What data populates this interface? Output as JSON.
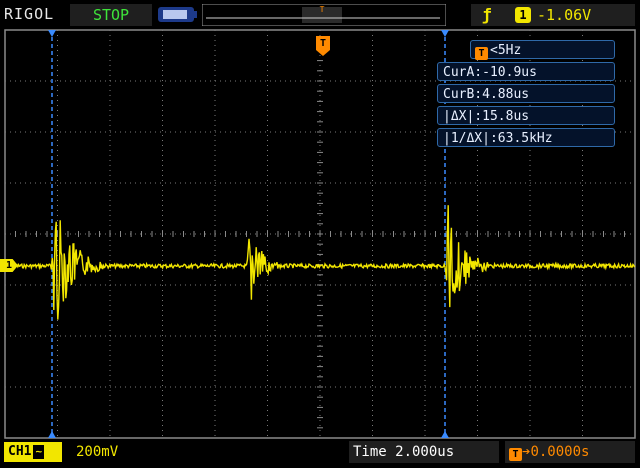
{
  "header": {
    "brand": "RIGOL",
    "run_state": "STOP",
    "trigger_slope_icon": "rising-edge-icon",
    "trigger_source": "1",
    "trigger_level": "-1.06V",
    "overview_marker": "T"
  },
  "cursor_panel": {
    "freq_icon": "T",
    "freq": "<5Hz",
    "rows": [
      "CurA:-10.9us",
      "CurB:4.88us",
      "|ΔX|:15.8us",
      "|1/ΔX|:63.5kHz"
    ]
  },
  "markers": {
    "channel": "1",
    "trigger_position": "T"
  },
  "footer": {
    "channel_label": "CH1",
    "coupling": "~",
    "volts_per_div": "200mV",
    "time_base": "Time 2.000us",
    "trigger_offset_icon": "T",
    "trigger_offset": "0.0000s"
  },
  "colors": {
    "channel1": "#f2e600",
    "cursor": "#3a8bff",
    "trigger": "#ff8a00",
    "run_state": "#3ee43a"
  }
}
